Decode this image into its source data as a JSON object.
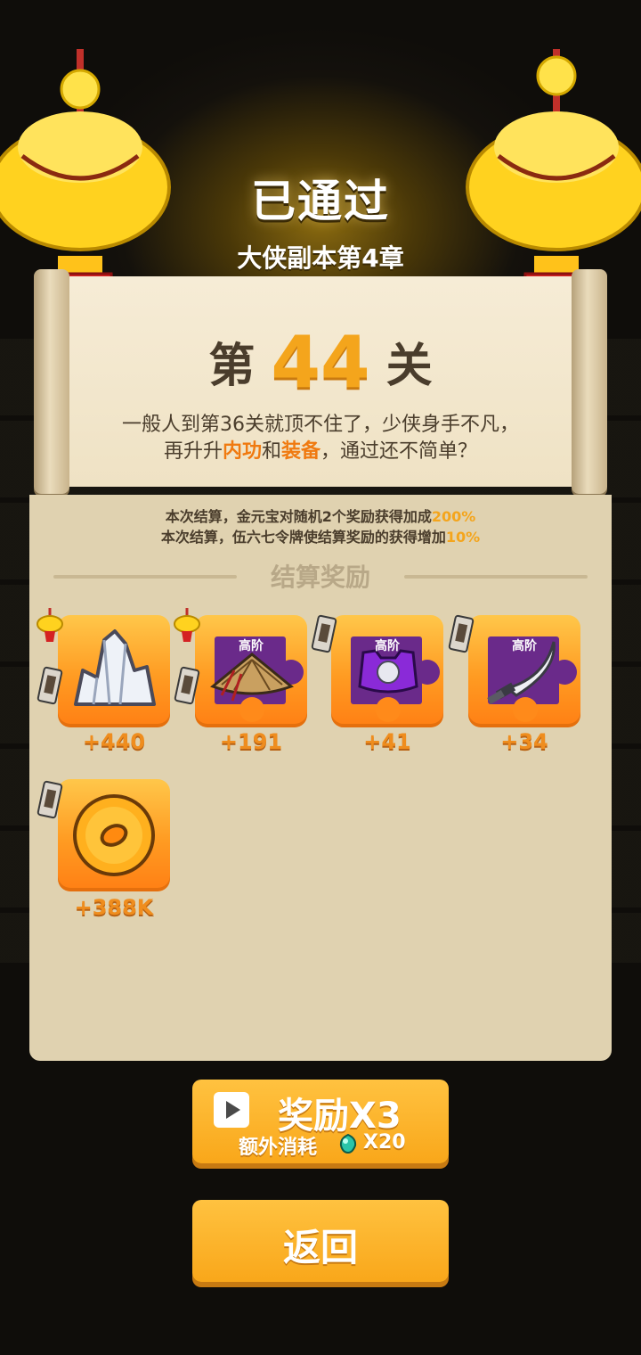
{
  "header": {
    "title": "已通过",
    "subtitle": "大侠副本第4章"
  },
  "level": {
    "prefix": "第",
    "number": "44",
    "suffix": "关"
  },
  "tip": {
    "line1": "一般人到第36关就顶不住了，少侠身手不凡，",
    "line2_a": "再升升",
    "line2_hl1": "内功",
    "line2_b": "和",
    "line2_hl2": "装备",
    "line2_c": "，通过还不简单？"
  },
  "bonus": {
    "line1_text": "本次结算，金元宝对随机2个奖励获得加成",
    "line1_pct": "200%",
    "line2_text": "本次结算，伍六七令牌使结算奖励的获得增加",
    "line2_pct": "10%"
  },
  "rewards_title": "结算奖励",
  "rewards": [
    {
      "item": "crystal",
      "qty": "+440",
      "tier": ""
    },
    {
      "item": "straw-hat",
      "qty": "+191",
      "tier": "高阶"
    },
    {
      "item": "armor",
      "qty": "+41",
      "tier": "高阶"
    },
    {
      "item": "saber",
      "qty": "+34",
      "tier": "高阶"
    },
    {
      "item": "coin",
      "qty": "+388K",
      "tier": ""
    }
  ],
  "buttons": {
    "reward_x3": "奖励X3",
    "extra_cost_label": "额外消耗",
    "extra_cost_value": "X20",
    "back": "返回"
  },
  "icons": {
    "play": "play-icon",
    "gem": "gem-icon",
    "ingot_badge": "gold-ingot-icon",
    "token_badge": "token-icon"
  },
  "colors": {
    "accent_orange": "#f4a51c",
    "highlight_text": "#f07a10",
    "panel_bg": "#e0d2b0",
    "scroll_bg": "#f6ecd6"
  }
}
